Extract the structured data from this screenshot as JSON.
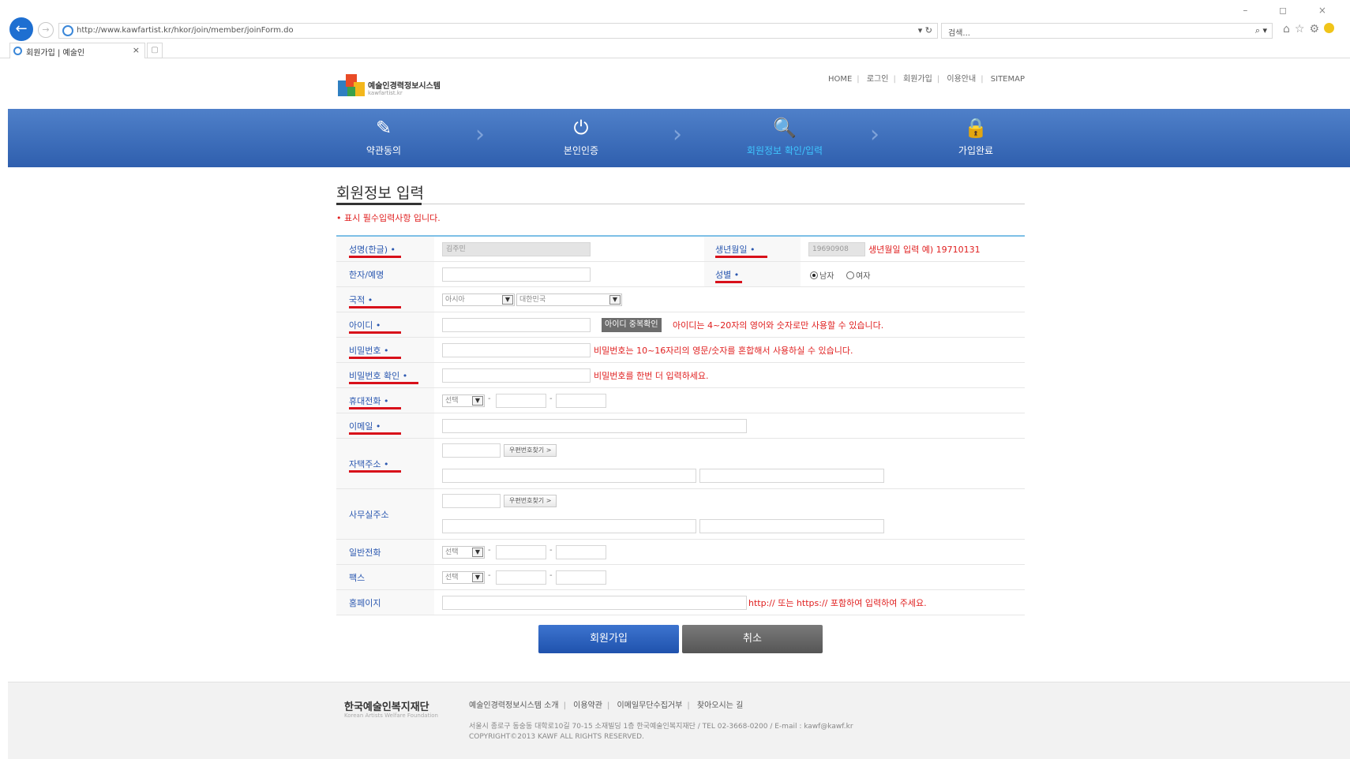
{
  "browser": {
    "url": "http://www.kawfartist.kr/hkor/join/member/joinForm.do",
    "search_placeholder": "검색...",
    "tab_title": "회원가입 | 예술인",
    "tab_close": "×",
    "window_controls": "– ◻ ×"
  },
  "site": {
    "logo_name": "예술인경력정보시스템",
    "logo_sub": "kawfartist.kr",
    "topnav": [
      "HOME",
      "로그인",
      "회원가입",
      "이용안내",
      "SITEMAP"
    ]
  },
  "steps": [
    {
      "label": "약관동의",
      "icon": "document-pen-icon",
      "active": false
    },
    {
      "label": "본인인증",
      "icon": "power-icon",
      "active": false
    },
    {
      "label": "회원정보 확인/입력",
      "icon": "person-search-icon",
      "active": true
    },
    {
      "label": "가입완료",
      "icon": "lock-icon",
      "active": false
    }
  ],
  "form": {
    "title": "회원정보 입력",
    "required_note": "• 표시 필수입력사항 입니다.",
    "labels": {
      "name_kr": "성명(한글) •",
      "birth": "생년월일 •",
      "name_en": "한자/예명",
      "gender": "성별 •",
      "nationality": "국적 •",
      "user_id": "아이디 •",
      "password": "비밀번호 •",
      "password_confirm": "비밀번호 확인 •",
      "mobile": "휴대전화 •",
      "email": "이메일 •",
      "home_address": "자택주소 •",
      "office_address": "사무실주소",
      "phone": "일반전화",
      "fax": "팩스",
      "homepage": "홈페이지"
    },
    "values": {
      "name_kr": "김주민",
      "birth": "19690908",
      "nation_region": "아시아",
      "nation_country": "대한민국",
      "phone_prefix": "선택",
      "dash": "-"
    },
    "hints": {
      "birth": "생년월일 입력 예) 19710131",
      "user_id": "아이디는 4~20자의 영어와 숫자로만 사용할 수 있습니다.",
      "password": "비밀번호는 10~16자리의 영문/숫자를 혼합해서 사용하실 수 있습니다.",
      "password_confirm": "비밀번호를 한번 더 입력하세요.",
      "homepage": "http:// 또는 https:// 포함하여 입력하여 주세요."
    },
    "gender_options": {
      "male": "남자",
      "female": "여자",
      "selected": "male"
    },
    "id_check_button": "아이디 중복확인",
    "zip_button": "우편번호찾기 >"
  },
  "buttons": {
    "join": "회원가입",
    "cancel": "취소"
  },
  "footer": {
    "logo": "한국예술인복지재단",
    "logo_sub": "Korean Artists Welfare Foundation",
    "links": [
      "예술인경력정보시스템 소개",
      "이용약관",
      "이메일무단수집거부",
      "찾아오시는 길"
    ],
    "address": "서울시 종로구 동숭동 대학로10길 70-15 소재빌딩 1층 한국예술인복지재단 / TEL 02-3668-0200 / E-mail : kawf@kawf.kr",
    "copyright": "COPYRIGHT©2013 KAWF ALL RIGHTS RESERVED."
  }
}
